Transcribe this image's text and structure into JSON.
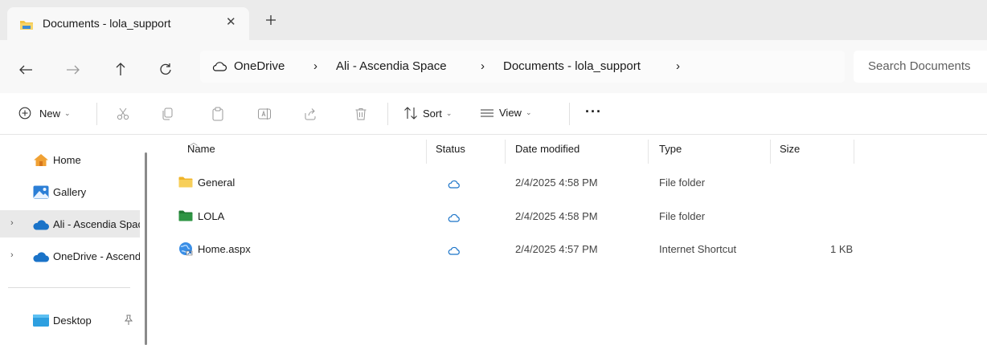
{
  "tab": {
    "title": "Documents - lola_support",
    "close_glyph": "✕",
    "new_tab_glyph": "+"
  },
  "nav": {
    "back": "←",
    "forward": "→",
    "up": "↑",
    "refresh": "C"
  },
  "breadcrumb": {
    "items": [
      "OneDrive",
      "Ali - Ascendia Space",
      "Documents - lola_support"
    ],
    "separator": "›"
  },
  "search": {
    "placeholder": "Search Documents"
  },
  "commands": {
    "new_label": "New",
    "sort_label": "Sort",
    "view_label": "View",
    "more_label": "···"
  },
  "sidebar": {
    "items": [
      {
        "label": "Home",
        "icon": "home-icon"
      },
      {
        "label": "Gallery",
        "icon": "gallery-icon"
      },
      {
        "label": "Ali - Ascendia Space",
        "icon": "cloud-icon",
        "selected": true,
        "expander": "›"
      },
      {
        "label": "OneDrive - Ascendia",
        "icon": "cloud-icon",
        "expander": "›"
      },
      {
        "label": "Desktop",
        "icon": "desktop-icon",
        "pinned": true
      }
    ]
  },
  "columns": {
    "name": "Name",
    "status": "Status",
    "date": "Date modified",
    "type": "Type",
    "size": "Size"
  },
  "files": [
    {
      "name": "General",
      "icon": "folder-icon",
      "date": "2/4/2025 4:58 PM",
      "type": "File folder",
      "size": ""
    },
    {
      "name": "LOLA",
      "icon": "green-folder-icon",
      "date": "2/4/2025 4:58 PM",
      "type": "File folder",
      "size": ""
    },
    {
      "name": "Home.aspx",
      "icon": "internet-shortcut-icon",
      "date": "2/4/2025 4:57 PM",
      "type": "Internet Shortcut",
      "size": "1 KB"
    }
  ],
  "colors": {
    "accent": "#0f6cbd",
    "folder": "#f3c443",
    "green_folder": "#2e8b3e",
    "cloud": "#1a73c8"
  }
}
